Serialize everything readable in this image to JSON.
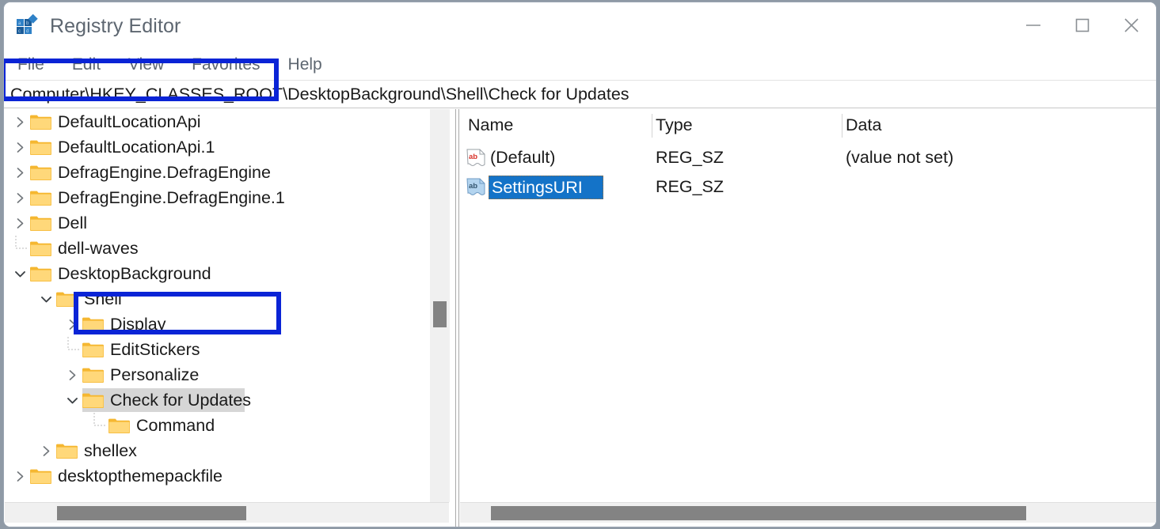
{
  "window": {
    "title": "Registry Editor",
    "icon": "registry-editor-icon",
    "controls": [
      {
        "name": "minimize-button",
        "glyph": "minimize"
      },
      {
        "name": "maximize-button",
        "glyph": "maximize"
      },
      {
        "name": "close-button",
        "glyph": "close"
      }
    ]
  },
  "menubar": {
    "items": [
      "File",
      "Edit",
      "View",
      "Favorites",
      "Help"
    ]
  },
  "address_bar": {
    "path": "Computer\\HKEY_CLASSES_ROOT\\DesktopBackground\\Shell\\Check for Updates"
  },
  "tree": {
    "items": [
      {
        "label": "DefaultLocationApi",
        "depth": 0,
        "state": "collapsed",
        "selected": false
      },
      {
        "label": "DefaultLocationApi.1",
        "depth": 0,
        "state": "collapsed",
        "selected": false
      },
      {
        "label": "DefragEngine.DefragEngine",
        "depth": 0,
        "state": "collapsed",
        "selected": false
      },
      {
        "label": "DefragEngine.DefragEngine.1",
        "depth": 0,
        "state": "collapsed",
        "selected": false
      },
      {
        "label": "Dell",
        "depth": 0,
        "state": "collapsed",
        "selected": false
      },
      {
        "label": "dell-waves",
        "depth": 0,
        "state": "leaf",
        "selected": false
      },
      {
        "label": "DesktopBackground",
        "depth": 0,
        "state": "expanded",
        "selected": false
      },
      {
        "label": "Shell",
        "depth": 1,
        "state": "expanded",
        "selected": false
      },
      {
        "label": "Display",
        "depth": 2,
        "state": "collapsed",
        "selected": false
      },
      {
        "label": "EditStickers",
        "depth": 2,
        "state": "leaf",
        "selected": false
      },
      {
        "label": "Personalize",
        "depth": 2,
        "state": "collapsed",
        "selected": false
      },
      {
        "label": "Check for Updates",
        "depth": 2,
        "state": "expanded",
        "selected": true
      },
      {
        "label": "Command",
        "depth": 3,
        "state": "leaf",
        "selected": false
      },
      {
        "label": "shellex",
        "depth": 1,
        "state": "collapsed",
        "selected": false
      },
      {
        "label": "desktopthemepackfile",
        "depth": 0,
        "state": "collapsed",
        "selected": false
      }
    ]
  },
  "values_list": {
    "columns": [
      "Name",
      "Type",
      "Data"
    ],
    "rows": [
      {
        "name": "(Default)",
        "type": "REG_SZ",
        "data": "(value not set)",
        "icon": "string-value-icon",
        "editing": false
      },
      {
        "name": "SettingsURI",
        "type": "REG_SZ",
        "data": "",
        "icon": "string-value-icon",
        "editing": true
      }
    ]
  },
  "annotations": [
    {
      "name": "annotation-box-check-for-updates",
      "color": "#0a24d6"
    },
    {
      "name": "annotation-box-settingsuri",
      "color": "#0a24d6"
    }
  ],
  "scrollbars": {
    "tree_vertical": "tree-vertical-scrollbar",
    "tree_horizontal": "tree-horizontal-scrollbar",
    "list_horizontal": "list-horizontal-scrollbar"
  }
}
